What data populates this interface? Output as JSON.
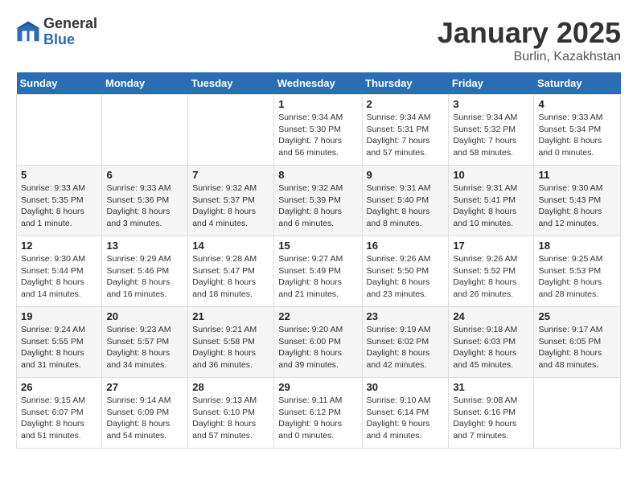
{
  "logo": {
    "general": "General",
    "blue": "Blue"
  },
  "title": "January 2025",
  "subtitle": "Burlin, Kazakhstan",
  "weekdays": [
    "Sunday",
    "Monday",
    "Tuesday",
    "Wednesday",
    "Thursday",
    "Friday",
    "Saturday"
  ],
  "weeks": [
    [
      {
        "day": "",
        "sunrise": "",
        "sunset": "",
        "daylight": ""
      },
      {
        "day": "",
        "sunrise": "",
        "sunset": "",
        "daylight": ""
      },
      {
        "day": "",
        "sunrise": "",
        "sunset": "",
        "daylight": ""
      },
      {
        "day": "1",
        "sunrise": "Sunrise: 9:34 AM",
        "sunset": "Sunset: 5:30 PM",
        "daylight": "Daylight: 7 hours and 56 minutes."
      },
      {
        "day": "2",
        "sunrise": "Sunrise: 9:34 AM",
        "sunset": "Sunset: 5:31 PM",
        "daylight": "Daylight: 7 hours and 57 minutes."
      },
      {
        "day": "3",
        "sunrise": "Sunrise: 9:34 AM",
        "sunset": "Sunset: 5:32 PM",
        "daylight": "Daylight: 7 hours and 58 minutes."
      },
      {
        "day": "4",
        "sunrise": "Sunrise: 9:33 AM",
        "sunset": "Sunset: 5:34 PM",
        "daylight": "Daylight: 8 hours and 0 minutes."
      }
    ],
    [
      {
        "day": "5",
        "sunrise": "Sunrise: 9:33 AM",
        "sunset": "Sunset: 5:35 PM",
        "daylight": "Daylight: 8 hours and 1 minute."
      },
      {
        "day": "6",
        "sunrise": "Sunrise: 9:33 AM",
        "sunset": "Sunset: 5:36 PM",
        "daylight": "Daylight: 8 hours and 3 minutes."
      },
      {
        "day": "7",
        "sunrise": "Sunrise: 9:32 AM",
        "sunset": "Sunset: 5:37 PM",
        "daylight": "Daylight: 8 hours and 4 minutes."
      },
      {
        "day": "8",
        "sunrise": "Sunrise: 9:32 AM",
        "sunset": "Sunset: 5:39 PM",
        "daylight": "Daylight: 8 hours and 6 minutes."
      },
      {
        "day": "9",
        "sunrise": "Sunrise: 9:31 AM",
        "sunset": "Sunset: 5:40 PM",
        "daylight": "Daylight: 8 hours and 8 minutes."
      },
      {
        "day": "10",
        "sunrise": "Sunrise: 9:31 AM",
        "sunset": "Sunset: 5:41 PM",
        "daylight": "Daylight: 8 hours and 10 minutes."
      },
      {
        "day": "11",
        "sunrise": "Sunrise: 9:30 AM",
        "sunset": "Sunset: 5:43 PM",
        "daylight": "Daylight: 8 hours and 12 minutes."
      }
    ],
    [
      {
        "day": "12",
        "sunrise": "Sunrise: 9:30 AM",
        "sunset": "Sunset: 5:44 PM",
        "daylight": "Daylight: 8 hours and 14 minutes."
      },
      {
        "day": "13",
        "sunrise": "Sunrise: 9:29 AM",
        "sunset": "Sunset: 5:46 PM",
        "daylight": "Daylight: 8 hours and 16 minutes."
      },
      {
        "day": "14",
        "sunrise": "Sunrise: 9:28 AM",
        "sunset": "Sunset: 5:47 PM",
        "daylight": "Daylight: 8 hours and 18 minutes."
      },
      {
        "day": "15",
        "sunrise": "Sunrise: 9:27 AM",
        "sunset": "Sunset: 5:49 PM",
        "daylight": "Daylight: 8 hours and 21 minutes."
      },
      {
        "day": "16",
        "sunrise": "Sunrise: 9:26 AM",
        "sunset": "Sunset: 5:50 PM",
        "daylight": "Daylight: 8 hours and 23 minutes."
      },
      {
        "day": "17",
        "sunrise": "Sunrise: 9:26 AM",
        "sunset": "Sunset: 5:52 PM",
        "daylight": "Daylight: 8 hours and 26 minutes."
      },
      {
        "day": "18",
        "sunrise": "Sunrise: 9:25 AM",
        "sunset": "Sunset: 5:53 PM",
        "daylight": "Daylight: 8 hours and 28 minutes."
      }
    ],
    [
      {
        "day": "19",
        "sunrise": "Sunrise: 9:24 AM",
        "sunset": "Sunset: 5:55 PM",
        "daylight": "Daylight: 8 hours and 31 minutes."
      },
      {
        "day": "20",
        "sunrise": "Sunrise: 9:23 AM",
        "sunset": "Sunset: 5:57 PM",
        "daylight": "Daylight: 8 hours and 34 minutes."
      },
      {
        "day": "21",
        "sunrise": "Sunrise: 9:21 AM",
        "sunset": "Sunset: 5:58 PM",
        "daylight": "Daylight: 8 hours and 36 minutes."
      },
      {
        "day": "22",
        "sunrise": "Sunrise: 9:20 AM",
        "sunset": "Sunset: 6:00 PM",
        "daylight": "Daylight: 8 hours and 39 minutes."
      },
      {
        "day": "23",
        "sunrise": "Sunrise: 9:19 AM",
        "sunset": "Sunset: 6:02 PM",
        "daylight": "Daylight: 8 hours and 42 minutes."
      },
      {
        "day": "24",
        "sunrise": "Sunrise: 9:18 AM",
        "sunset": "Sunset: 6:03 PM",
        "daylight": "Daylight: 8 hours and 45 minutes."
      },
      {
        "day": "25",
        "sunrise": "Sunrise: 9:17 AM",
        "sunset": "Sunset: 6:05 PM",
        "daylight": "Daylight: 8 hours and 48 minutes."
      }
    ],
    [
      {
        "day": "26",
        "sunrise": "Sunrise: 9:15 AM",
        "sunset": "Sunset: 6:07 PM",
        "daylight": "Daylight: 8 hours and 51 minutes."
      },
      {
        "day": "27",
        "sunrise": "Sunrise: 9:14 AM",
        "sunset": "Sunset: 6:09 PM",
        "daylight": "Daylight: 8 hours and 54 minutes."
      },
      {
        "day": "28",
        "sunrise": "Sunrise: 9:13 AM",
        "sunset": "Sunset: 6:10 PM",
        "daylight": "Daylight: 8 hours and 57 minutes."
      },
      {
        "day": "29",
        "sunrise": "Sunrise: 9:11 AM",
        "sunset": "Sunset: 6:12 PM",
        "daylight": "Daylight: 9 hours and 0 minutes."
      },
      {
        "day": "30",
        "sunrise": "Sunrise: 9:10 AM",
        "sunset": "Sunset: 6:14 PM",
        "daylight": "Daylight: 9 hours and 4 minutes."
      },
      {
        "day": "31",
        "sunrise": "Sunrise: 9:08 AM",
        "sunset": "Sunset: 6:16 PM",
        "daylight": "Daylight: 9 hours and 7 minutes."
      },
      {
        "day": "",
        "sunrise": "",
        "sunset": "",
        "daylight": ""
      }
    ]
  ]
}
